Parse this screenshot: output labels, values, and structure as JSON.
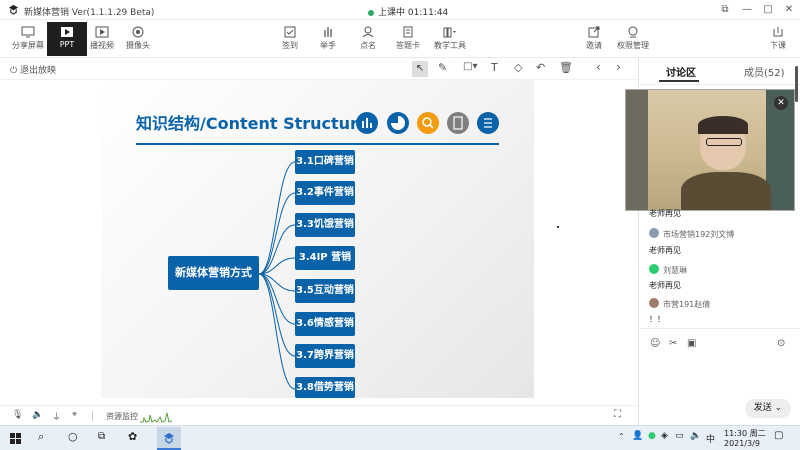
{
  "titlebar": {
    "app_title": "新媒体营销 Ver(1.1.1.29 Beta)",
    "status": "上课中 01:11:44"
  },
  "toolbar": {
    "left": [
      "分享屏幕",
      "PPT",
      "播视频",
      "摄像头"
    ],
    "center": [
      "签到",
      "举手",
      "点名",
      "答题卡",
      "教学工具"
    ],
    "right": [
      "邀请",
      "权限管理",
      "下课"
    ]
  },
  "slidebar": {
    "exit_label": "退出放映"
  },
  "slide": {
    "title": "知识结构/Content Structure",
    "root": "新媒体营销方式",
    "items": [
      "3.1口碑营销",
      "3.2事件营销",
      "3.3饥饿营销",
      "3.4IP 营销",
      "3.5互动营销",
      "3.6情感营销",
      "3.7跨界营销",
      "3.8借势营销"
    ],
    "icon_colors": [
      "#0a62a8",
      "#0a62a8",
      "#f39c12",
      "#7f7f7f",
      "#0a62a8"
    ]
  },
  "bottombar": {
    "resource_label": "资源监控"
  },
  "panel": {
    "tabs": {
      "discussion": "讨论区",
      "members": "成员(52)"
    },
    "messages": [
      {
        "name": "",
        "text": "老师再见"
      },
      {
        "name": "市场营销192刘文博",
        "text": "老师再见"
      },
      {
        "name": "刘慧琳",
        "text": "老师再见"
      },
      {
        "name": "市营191赵倩",
        "text": "！！"
      }
    ],
    "send_label": "发送"
  },
  "taskbar": {
    "time": "11:30 周二",
    "date": "2021/3/9",
    "ime": "中"
  }
}
